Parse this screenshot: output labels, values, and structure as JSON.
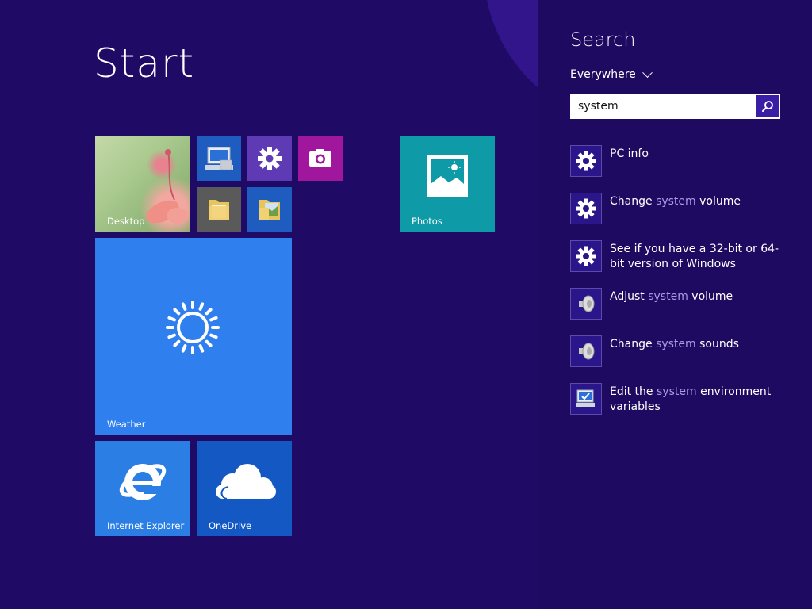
{
  "start": {
    "title": "Start",
    "tiles": {
      "desktop": "Desktop",
      "photos": "Photos",
      "weather": "Weather",
      "ie": "Internet Explorer",
      "onedrive": "OneDrive"
    }
  },
  "search": {
    "title": "Search",
    "scope": "Everywhere",
    "query": "system",
    "results": [
      {
        "icon": "gear-icon",
        "parts": [
          "PC info"
        ]
      },
      {
        "icon": "gear-icon",
        "parts": [
          "Change ",
          "system",
          " volume"
        ]
      },
      {
        "icon": "gear-icon",
        "parts": [
          "See if you have a 32-bit or 64-bit version of Windows"
        ]
      },
      {
        "icon": "speaker-icon",
        "parts": [
          "Adjust ",
          "system",
          " volume"
        ]
      },
      {
        "icon": "speaker-icon",
        "parts": [
          "Change ",
          "system",
          " sounds"
        ]
      },
      {
        "icon": "computer-settings-icon",
        "parts": [
          "Edit the ",
          "system",
          " environment variables"
        ]
      }
    ]
  },
  "colors": {
    "background": "#1f0a66",
    "pane": "#1e0a60",
    "highlight": "#a99be8"
  }
}
